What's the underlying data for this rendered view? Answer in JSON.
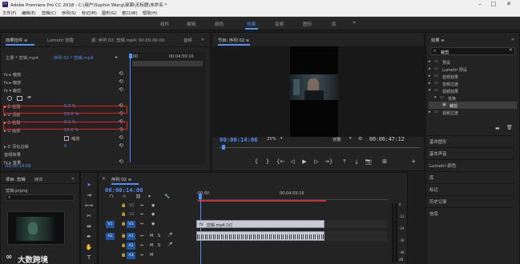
{
  "window": {
    "title": "Adobe Premiere Pro CC 2018 - C:\\用户\\Sophie Wong\\桌面\\无标题\\未命名 *",
    "app_icon": "Pr"
  },
  "menu": [
    "文件(F)",
    "编辑(E)",
    "剪辑(C)",
    "序列(S)",
    "标记(M)",
    "图形(G)",
    "窗口(W)",
    "帮助(H)"
  ],
  "workspaces": [
    "组件",
    "编辑",
    "颜色",
    "效果",
    "音频",
    "图形",
    "库"
  ],
  "active_workspace": "效果",
  "workspace_more": "»",
  "effect_controls": {
    "tabs": [
      "效果控件 ≡",
      "Lumetri 范围",
      "源: 序列 02: 剪辑.mp4: 00:00:00:00",
      "音频"
    ],
    "tabs_more": "»",
    "master_label": "主要 * 剪辑.mp4",
    "sequence_label": "序列 02 * 剪辑.mp4",
    "ruler_start": "0:00",
    "ruler_end": "00:04:59:16",
    "rows": [
      {
        "label": "fx  ▸ 缩放",
        "value": ""
      },
      {
        "label": "fx  ▸ 缩放",
        "value": ""
      },
      {
        "label": "fx  ▾ 裁剪",
        "value": ""
      },
      {
        "label": "",
        "value": ""
      },
      {
        "label": "▸ ⏱ 左侧",
        "value": "0.0 %"
      },
      {
        "label": "▸ ⏱ 顶部",
        "value": "15.0 %"
      },
      {
        "label": "▸ ⏱ 右侧",
        "value": "0.0 %"
      },
      {
        "label": "▸ ⏱ 底部",
        "value": "15.0 %"
      },
      {
        "label": "",
        "value": ""
      },
      {
        "label": "▸ ⏱ 羽化边缘",
        "value": "0"
      },
      {
        "label": "音频效果",
        "value": ""
      },
      {
        "label": "fx  ▸ 音量",
        "value": ""
      }
    ],
    "zoom_checkbox_label": "缩放",
    "footer_timecode": "00:00:14:06"
  },
  "program": {
    "tab": "节目: 序列 02 ≡",
    "timecode": "00:00:14:06",
    "zoom": "25%",
    "quality": "完整",
    "duration": "00:06:47:12",
    "controls": [
      "{",
      "}",
      "{←",
      "◁|",
      "◁",
      "▶",
      "▷",
      "|▷",
      "→}",
      "⤒",
      "⤓",
      "📷",
      "⊞",
      "+"
    ]
  },
  "effects_panel": {
    "title": "效果 ≡",
    "search_value": "裁剪",
    "tree": [
      {
        "label": "预设",
        "depth": 0,
        "open": false
      },
      {
        "label": "Lumetri 预设",
        "depth": 0,
        "open": false
      },
      {
        "label": "音频效果",
        "depth": 0,
        "open": false
      },
      {
        "label": "音频过渡",
        "depth": 0,
        "open": false
      },
      {
        "label": "视频效果",
        "depth": 0,
        "open": true
      },
      {
        "label": "变换",
        "depth": 1,
        "open": true
      },
      {
        "label": "裁剪",
        "depth": 2,
        "open": false,
        "selected": true
      },
      {
        "label": "视频过渡",
        "depth": 0,
        "open": false
      }
    ],
    "sections": [
      "基本图形",
      "基本声音",
      "Lumetri 颜色",
      "库",
      "标记",
      "历史记录",
      "信息"
    ]
  },
  "project_panel": {
    "tabs": [
      "项目: 剪辑",
      "媒体"
    ],
    "tabs_more": "»",
    "file": "剪辑.prproj",
    "watermark": "大数跨境"
  },
  "timeline": {
    "tab": "序列 02 ≡",
    "timecode": "00:00:14:06",
    "ruler": [
      ":00:00",
      "00:04:59:16"
    ],
    "video_tracks": [
      "V3",
      "V2",
      "V1"
    ],
    "audio_tracks": [
      "A1",
      "A2",
      "A3"
    ],
    "source_patch_v": "V1",
    "source_patch_a": "A1",
    "clip_label": "剪辑.mp4 [V]",
    "meter_labels": [
      "0",
      "-12",
      "-24",
      "-36",
      "-48",
      "dB"
    ],
    "solo_labels": [
      "S",
      "S"
    ]
  },
  "colors": {
    "accent": "#4f8ff7",
    "highlight_box": "#e01f1f",
    "panel_bg": "#232323"
  }
}
